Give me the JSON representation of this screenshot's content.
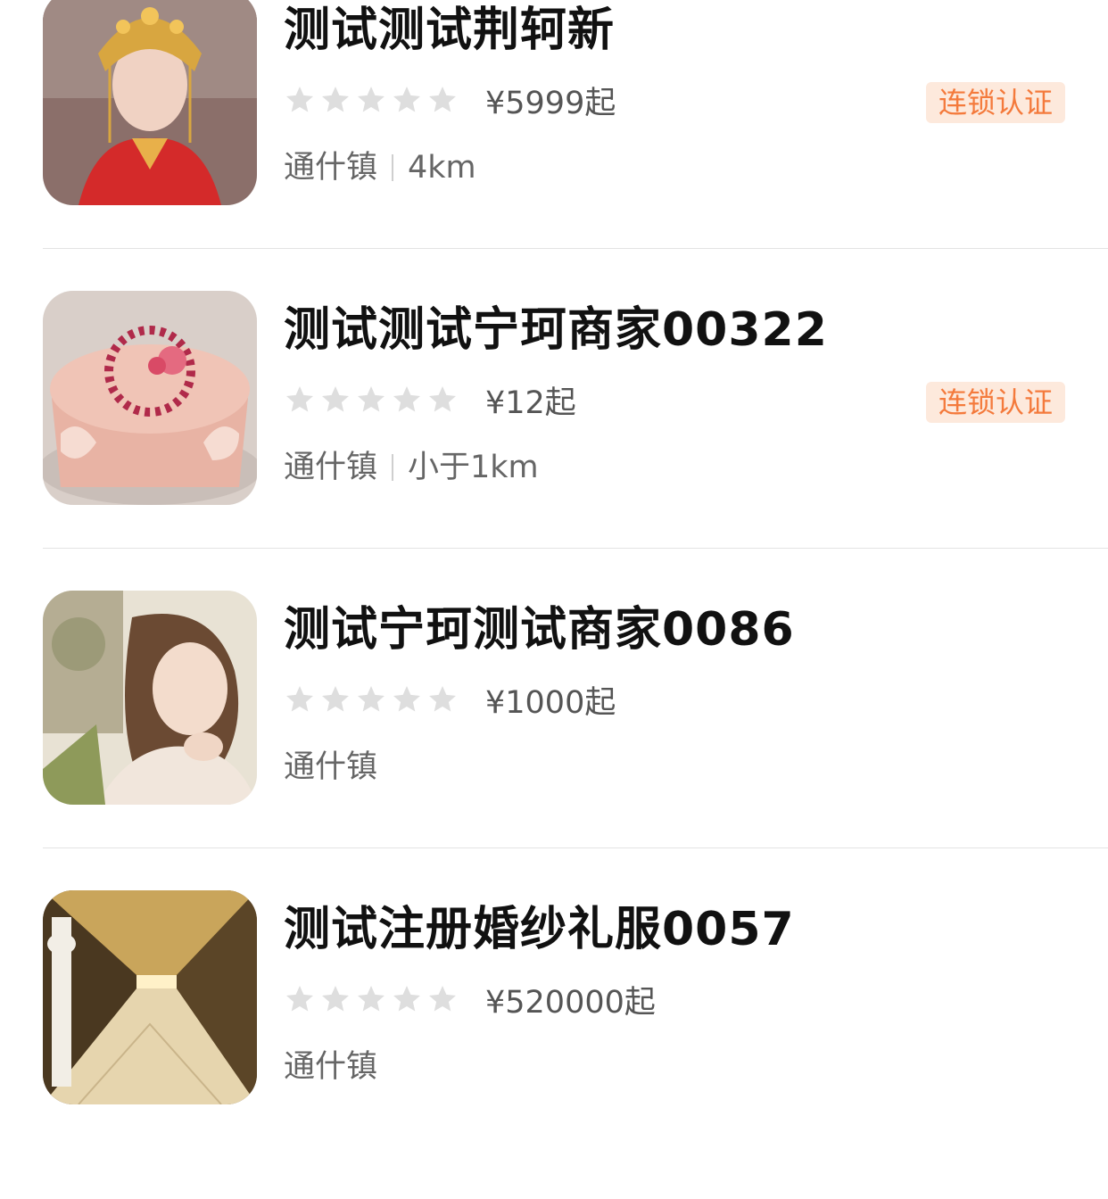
{
  "colors": {
    "badge_bg": "#fde9dc",
    "badge_text": "#f47a3c",
    "star_gray": "#dedede",
    "title": "#111111",
    "meta": "#666666"
  },
  "items": [
    {
      "title": "测试测试荆轲新",
      "rating": 0,
      "price": "¥5999起",
      "badge": "连锁认证",
      "town": "通什镇",
      "distance": "4km",
      "thumb_icon": "bride-photo-icon"
    },
    {
      "title": "测试测试宁珂商家00322",
      "rating": 0,
      "price": "¥12起",
      "badge": "连锁认证",
      "town": "通什镇",
      "distance": "小于1km",
      "thumb_icon": "cake-photo-icon"
    },
    {
      "title": "测试宁珂测试商家0086",
      "rating": 0,
      "price": "¥1000起",
      "badge": "",
      "town": "通什镇",
      "distance": "",
      "thumb_icon": "portrait-photo-icon"
    },
    {
      "title": "测试注册婚纱礼服0057",
      "rating": 0,
      "price": "¥520000起",
      "badge": "",
      "town": "通什镇",
      "distance": "",
      "thumb_icon": "hallway-photo-icon"
    }
  ]
}
